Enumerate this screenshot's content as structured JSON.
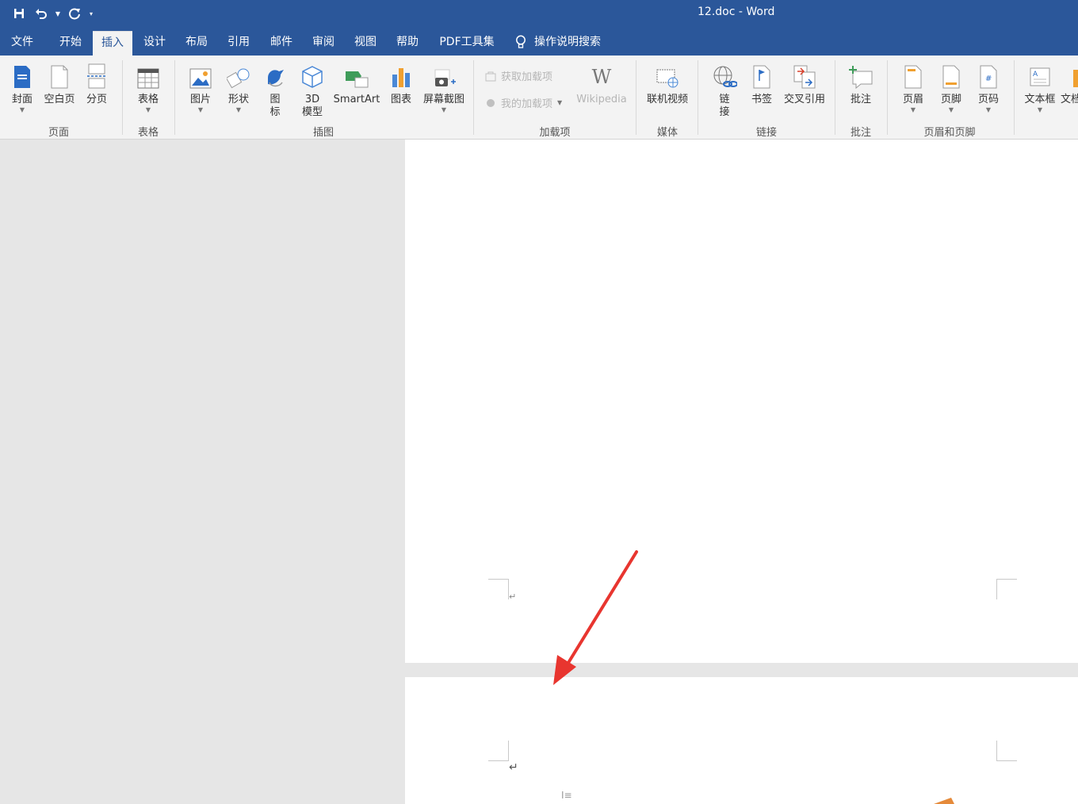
{
  "window": {
    "title": "12.doc  -  Word"
  },
  "qat": {
    "save_icon": "save-icon",
    "undo_icon": "undo-icon",
    "redo_icon": "redo-icon",
    "customize_icon": "customize-qat-icon"
  },
  "tabs": [
    {
      "label": "文件"
    },
    {
      "label": "开始"
    },
    {
      "label": "插入"
    },
    {
      "label": "设计"
    },
    {
      "label": "布局"
    },
    {
      "label": "引用"
    },
    {
      "label": "邮件"
    },
    {
      "label": "审阅"
    },
    {
      "label": "视图"
    },
    {
      "label": "帮助"
    },
    {
      "label": "PDF工具集"
    }
  ],
  "active_tab": "插入",
  "tell_me": {
    "label": "操作说明搜索",
    "icon": "lightbulb-icon"
  },
  "ribbon": {
    "pages": {
      "cover": "封面",
      "blank": "空白页",
      "page_break": "分页",
      "group": "页面"
    },
    "tables": {
      "table": "表格",
      "group": "表格"
    },
    "illustrations": {
      "picture": "图片",
      "shapes": "形状",
      "icons_line1": "图",
      "icons_line2": "标",
      "model_line1": "3D",
      "model_line2": "模型",
      "smartart": "SmartArt",
      "chart": "图表",
      "screenshot": "屏幕截图",
      "group": "插图"
    },
    "addins": {
      "get": "获取加载项",
      "mine": "我的加载项",
      "wikipedia": "Wikipedia",
      "group": "加载项"
    },
    "media": {
      "online_video": "联机视频",
      "group": "媒体"
    },
    "links": {
      "link_line1": "链",
      "link_line2": "接",
      "bookmark": "书签",
      "cross_ref": "交叉引用",
      "group": "链接"
    },
    "comments": {
      "comment": "批注",
      "group": "批注"
    },
    "header_footer": {
      "header": "页眉",
      "footer": "页脚",
      "page_number": "页码",
      "group": "页眉和页脚"
    },
    "text": {
      "textbox": "文本框",
      "more": "文档"
    }
  },
  "colors": {
    "brand": "#2b579a",
    "ribbon_bg": "#f3f3f3",
    "canvas": "#e6e6e6",
    "annotation_arrow": "#e8352f"
  }
}
